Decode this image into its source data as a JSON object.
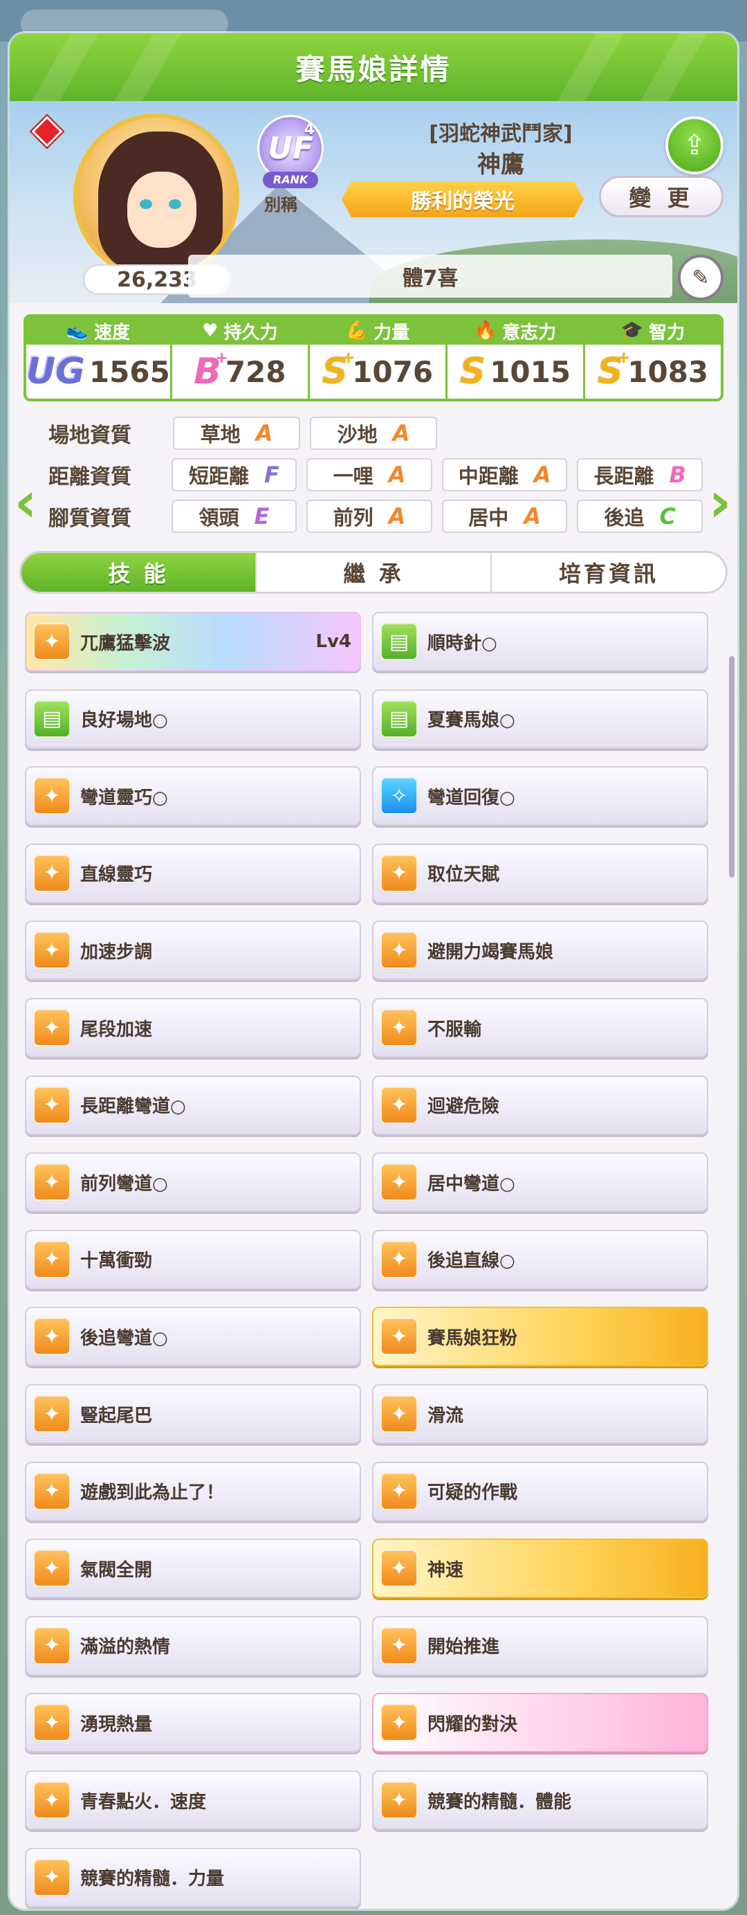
{
  "header": {
    "title": "賽馬娘詳情"
  },
  "profile": {
    "score": "26,233",
    "rank": {
      "grade": "UF",
      "sub": "4",
      "label": "RANK"
    },
    "nickname_label": "別稱",
    "title_line": "[羽蛇神武鬥家]",
    "name": "神鷹",
    "epithet": "勝利的榮光",
    "change_label": "變 更",
    "trainer": "體7喜"
  },
  "stats": [
    {
      "label": "速度",
      "grade": "UG",
      "value": "1565",
      "icon": "shoe-icon"
    },
    {
      "label": "持久力",
      "grade": "B",
      "plus": "+",
      "value": "728",
      "icon": "heart-icon"
    },
    {
      "label": "力量",
      "grade": "S",
      "plus": "+",
      "value": "1076",
      "icon": "muscle-icon"
    },
    {
      "label": "意志力",
      "grade": "S",
      "plus": "",
      "value": "1015",
      "icon": "fire-icon"
    },
    {
      "label": "智力",
      "grade": "S",
      "plus": "+",
      "value": "1083",
      "icon": "graduation-cap-icon"
    }
  ],
  "aptitudes": {
    "track": {
      "label": "場地資質",
      "items": [
        {
          "name": "草地",
          "grade": "A"
        },
        {
          "name": "沙地",
          "grade": "A"
        }
      ]
    },
    "distance": {
      "label": "距離資質",
      "items": [
        {
          "name": "短距離",
          "grade": "F"
        },
        {
          "name": "一哩",
          "grade": "A"
        },
        {
          "name": "中距離",
          "grade": "A"
        },
        {
          "name": "長距離",
          "grade": "B"
        }
      ]
    },
    "style": {
      "label": "腳質資質",
      "items": [
        {
          "name": "領頭",
          "grade": "E"
        },
        {
          "name": "前列",
          "grade": "A"
        },
        {
          "name": "居中",
          "grade": "A"
        },
        {
          "name": "後追",
          "grade": "C"
        }
      ]
    }
  },
  "tabs": [
    "技 能",
    "繼 承",
    "培育資訊"
  ],
  "skills": [
    {
      "name": "兀鷹猛擊波",
      "level": "Lv4",
      "style": "rainbow",
      "icon": "orange"
    },
    {
      "name": "順時針○",
      "style": "plain",
      "icon": "green"
    },
    {
      "name": "良好場地○",
      "style": "plain",
      "icon": "green"
    },
    {
      "name": "夏賽馬娘○",
      "style": "plain",
      "icon": "green"
    },
    {
      "name": "彎道靈巧○",
      "style": "plain",
      "icon": "orange"
    },
    {
      "name": "彎道回復○",
      "style": "plain",
      "icon": "blue"
    },
    {
      "name": "直線靈巧",
      "style": "plain",
      "icon": "orange"
    },
    {
      "name": "取位天賦",
      "style": "plain",
      "icon": "orange"
    },
    {
      "name": "加速步調",
      "style": "plain",
      "icon": "orange"
    },
    {
      "name": "避開力竭賽馬娘",
      "style": "plain",
      "icon": "orange"
    },
    {
      "name": "尾段加速",
      "style": "plain",
      "icon": "orange"
    },
    {
      "name": "不服輸",
      "style": "plain",
      "icon": "orange"
    },
    {
      "name": "長距離彎道○",
      "style": "plain",
      "icon": "orange"
    },
    {
      "name": "迴避危險",
      "style": "plain",
      "icon": "orange"
    },
    {
      "name": "前列彎道○",
      "style": "plain",
      "icon": "orange"
    },
    {
      "name": "居中彎道○",
      "style": "plain",
      "icon": "orange"
    },
    {
      "name": "十萬衝勁",
      "style": "plain",
      "icon": "orange"
    },
    {
      "name": "後追直線○",
      "style": "plain",
      "icon": "orange"
    },
    {
      "name": "後追彎道○",
      "style": "plain",
      "icon": "orange"
    },
    {
      "name": "賽馬娘狂粉",
      "style": "gold",
      "icon": "orange"
    },
    {
      "name": "豎起尾巴",
      "style": "plain",
      "icon": "orange"
    },
    {
      "name": "滑流",
      "style": "plain",
      "icon": "orange"
    },
    {
      "name": "遊戲到此為止了！",
      "style": "plain",
      "icon": "orange"
    },
    {
      "name": "可疑的作戰",
      "style": "plain",
      "icon": "orange"
    },
    {
      "name": "氣閥全開",
      "style": "plain",
      "icon": "orange"
    },
    {
      "name": "神速",
      "style": "gold",
      "icon": "orange"
    },
    {
      "name": "滿溢的熱情",
      "style": "plain",
      "icon": "orange"
    },
    {
      "name": "開始推進",
      "style": "plain",
      "icon": "orange"
    },
    {
      "name": "湧現熱量",
      "style": "plain",
      "icon": "orange"
    },
    {
      "name": "閃耀的對決",
      "style": "pink",
      "icon": "orange"
    },
    {
      "name": "青春點火．速度",
      "style": "plain",
      "icon": "orange"
    },
    {
      "name": "競賽的精髓．體能",
      "style": "plain",
      "icon": "orange"
    },
    {
      "name": "競賽的精髓．力量",
      "style": "plain",
      "icon": "orange"
    }
  ]
}
